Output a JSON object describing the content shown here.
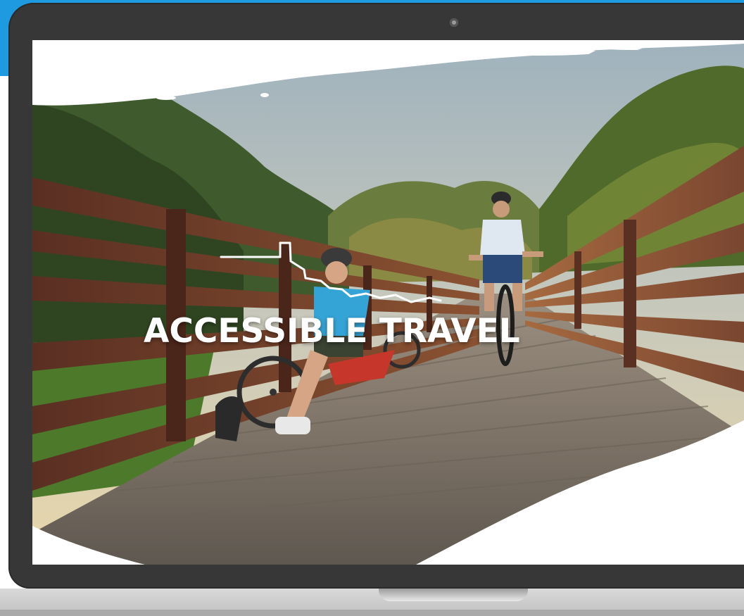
{
  "hero": {
    "headline": "ACCESSIBLE TRAVEL"
  },
  "icons": {
    "outline": "state-outline-icon",
    "camera": "webcam-icon"
  },
  "colors": {
    "brand_blue": "#1e9be0",
    "laptop_frame": "#373737",
    "laptop_base": "#c6c6c6",
    "headline_text": "#ffffff"
  }
}
